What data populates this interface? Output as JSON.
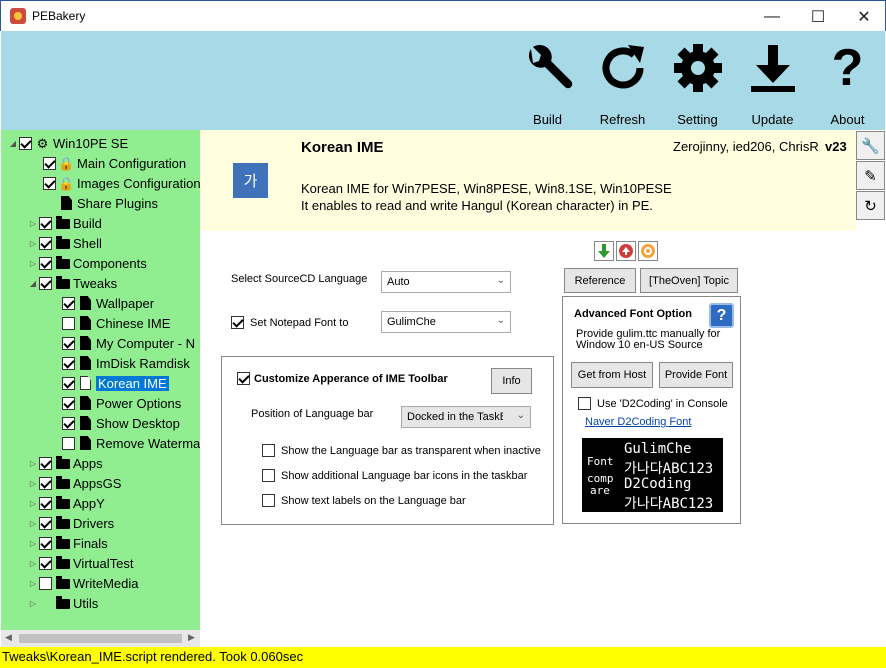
{
  "window": {
    "title": "PEBakery",
    "min": "—",
    "max": "☐",
    "close": "✕"
  },
  "toolbar": {
    "build": "Build",
    "refresh": "Refresh",
    "setting": "Setting",
    "update": "Update",
    "about": "About"
  },
  "tree": {
    "root": "Win10PE SE",
    "items": [
      "Main Configuration",
      "Images Configuration",
      "Share Plugins",
      "Build",
      "Shell",
      "Components",
      "Tweaks",
      "Wallpaper",
      "Chinese IME",
      "My Computer - N",
      "ImDisk Ramdisk",
      "Korean IME",
      "Power Options",
      "Show Desktop",
      "Remove Waterma",
      "Apps",
      "AppsGS",
      "AppY",
      "Drivers",
      "Finals",
      "VirtualTest",
      "WriteMedia",
      "Utils"
    ]
  },
  "header": {
    "icon_text": "가",
    "name": "Korean IME",
    "author": "Zerojinny, ied206, ChrisR",
    "version": "v23",
    "desc1": "Korean IME for Win7PESE, Win8PESE, Win8.1SE, Win10PESE",
    "desc2": "It enables to read and write Hangul (Korean character) in PE."
  },
  "form": {
    "source_lang_label": "Select SourceCD Language",
    "source_lang_value": "Auto",
    "notepad_font_label": "Set Notepad Font to",
    "notepad_font_value": "GulimChe",
    "customize_label": "Customize Apperance of IME Toolbar",
    "info_btn": "Info",
    "position_label": "Position of Language bar",
    "position_value": "Docked in the TaskBar",
    "opt1": "Show the Language bar as transparent when inactive",
    "opt2": "Show additional Language bar icons in the taskbar",
    "opt3": "Show text labels on the Language bar"
  },
  "right": {
    "reference_btn": "Reference",
    "theoven_btn": "[TheOven] Topic",
    "adv_title": "Advanced Font Option",
    "adv_help": "?",
    "adv_desc1": "Provide gulim.ttc manually for",
    "adv_desc2": "Window 10 en-US Source",
    "get_host_btn": "Get from Host",
    "provide_font_btn": "Provide Font",
    "d2coding_label": "Use 'D2Coding' in Console",
    "naver_link": "Naver D2Coding Font",
    "font_preview": {
      "left1": "Font",
      "left2": "comp",
      "left3": "are",
      "r1": "GulimChe",
      "r2": "가나다ABC123",
      "r3": "D2Coding",
      "r4": "가나다ABC123"
    }
  },
  "status": "Tweaks\\Korean_IME.script rendered. Took 0.060sec"
}
